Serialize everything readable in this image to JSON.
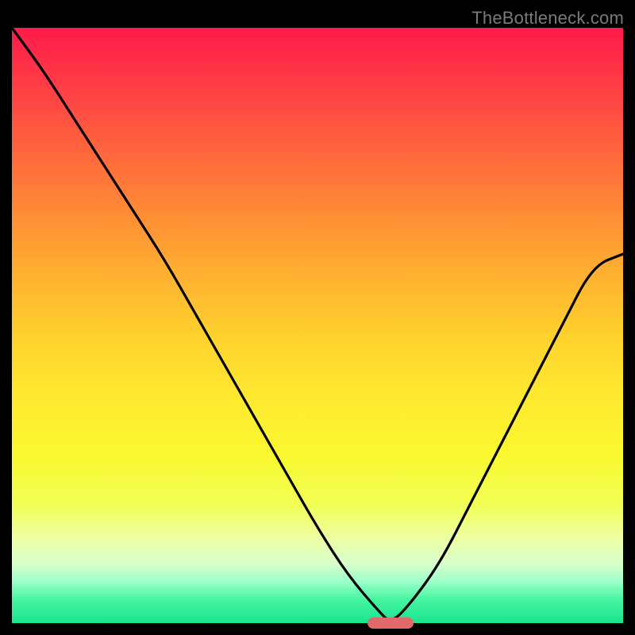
{
  "watermark": "TheBottleneck.com",
  "chart_data": {
    "type": "line",
    "title": "",
    "xlabel": "",
    "ylabel": "",
    "xlim": [
      0,
      100
    ],
    "ylim": [
      0,
      100
    ],
    "grid": false,
    "gradient_background": {
      "top_color": "#ff1a4a",
      "bottom_color": "#18e58f",
      "description": "vertical red-orange-yellow-green gradient"
    },
    "series": [
      {
        "name": "bottleneck-curve",
        "x": [
          0,
          5,
          10,
          15,
          20,
          25,
          30,
          35,
          40,
          45,
          50,
          55,
          60,
          62,
          65,
          70,
          75,
          80,
          85,
          90,
          95,
          100
        ],
        "values": [
          100,
          93,
          85,
          77,
          69,
          61,
          52,
          43,
          34,
          25,
          16,
          8,
          2,
          0,
          3,
          10,
          20,
          30,
          40,
          50,
          60,
          62
        ]
      }
    ],
    "marker": {
      "name": "current-selection",
      "x": 62,
      "y": 0,
      "color": "#e26a6a",
      "shape": "pill"
    }
  },
  "colors": {
    "frame_background": "#000000",
    "curve_stroke": "#000000",
    "marker_fill": "#e26a6a",
    "watermark_text": "#7a7a7a"
  }
}
